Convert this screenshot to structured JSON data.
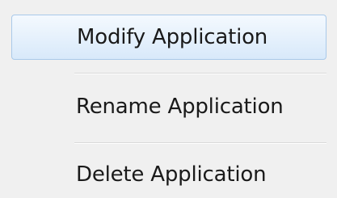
{
  "menu": {
    "items": [
      {
        "label": "Modify Application",
        "state": "hovered"
      },
      {
        "label": "Rename Application",
        "state": "normal"
      },
      {
        "label": "Delete Application",
        "state": "normal"
      }
    ]
  },
  "colors": {
    "background": "#f0f0f0",
    "hover_border": "#a9c9ea",
    "hover_fill": "#e6f1fc",
    "text": "#1a1a1a",
    "separator": "#d9d9d9"
  }
}
